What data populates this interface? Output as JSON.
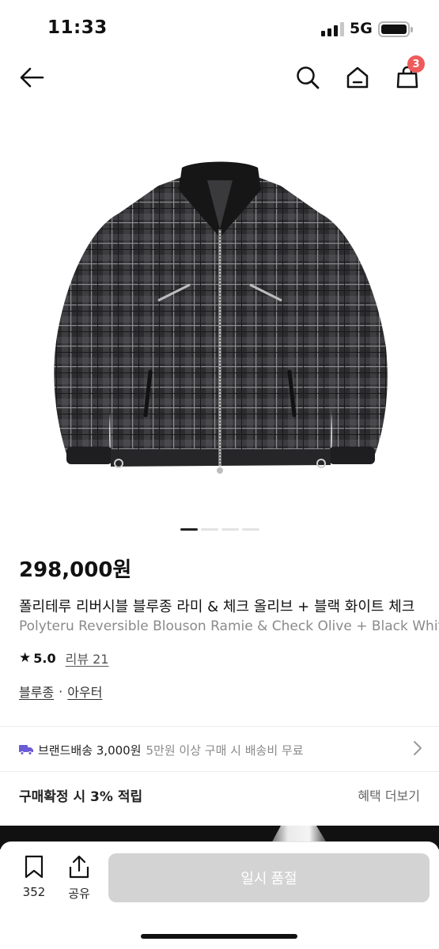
{
  "status": {
    "time": "11:33",
    "network": "5G",
    "signal_bars_active": 3,
    "signal_bars_total": 4,
    "battery_level": 0.9
  },
  "nav": {
    "back_icon": "arrow-left-icon",
    "search_icon": "search-icon",
    "home_icon": "home-icon",
    "cart_icon": "shopping-bag-icon",
    "cart_count": "3"
  },
  "gallery": {
    "image_alt": "black check reversible blouson",
    "slide_count": 4,
    "active_slide": 1
  },
  "product": {
    "price": "298,000원",
    "title_ko": "폴리테루 리버시블 블루종 라미 & 체크 올리브 + 블랙 화이트 체크",
    "title_en": "Polyteru Reversible Blouson Ramie & Check Olive + Black White Check",
    "rating": "5.0",
    "review_label": "리뷰 21",
    "category_1": "블루종",
    "category_sep": "·",
    "category_2": "아우터"
  },
  "shipping": {
    "icon": "truck-icon",
    "label": "브랜드배송 3,000원",
    "note": "5만원 이상 구매 시 배송비 무료"
  },
  "points": {
    "label": "구매확정 시 3% 적립",
    "more": "혜택 더보기"
  },
  "bottom": {
    "bookmark_count": "352",
    "share_label": "공유",
    "cta_label": "일시 품절"
  },
  "colors": {
    "badge": "#ee5a5a",
    "truck": "#6b5cd6",
    "cta_disabled": "#d3d3d3"
  }
}
